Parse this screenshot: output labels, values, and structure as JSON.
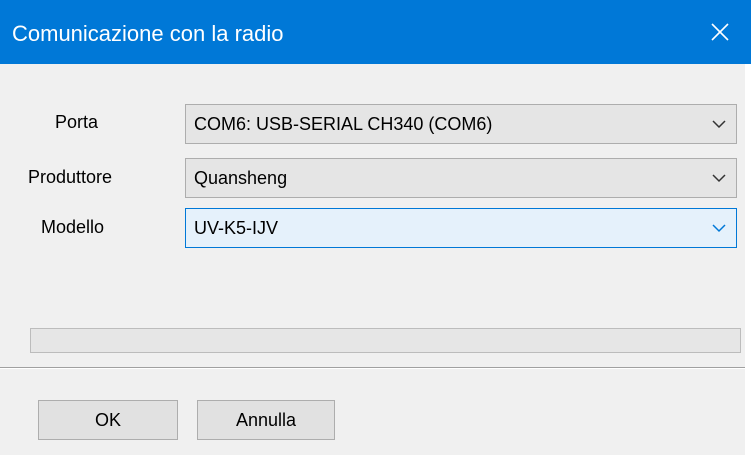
{
  "window": {
    "title": "Comunicazione con la radio",
    "close_icon": "close-icon",
    "titlebar_color": "#0078d7"
  },
  "form": {
    "port": {
      "label": "Porta",
      "value": "COM6: USB-SERIAL CH340 (COM6)"
    },
    "manufacturer": {
      "label": "Produttore",
      "value": "Quansheng"
    },
    "model": {
      "label": "Modello",
      "value": "UV-K5-IJV"
    }
  },
  "progress": {
    "fraction": 0
  },
  "buttons": {
    "ok_label": "OK",
    "cancel_label": "Annulla"
  }
}
